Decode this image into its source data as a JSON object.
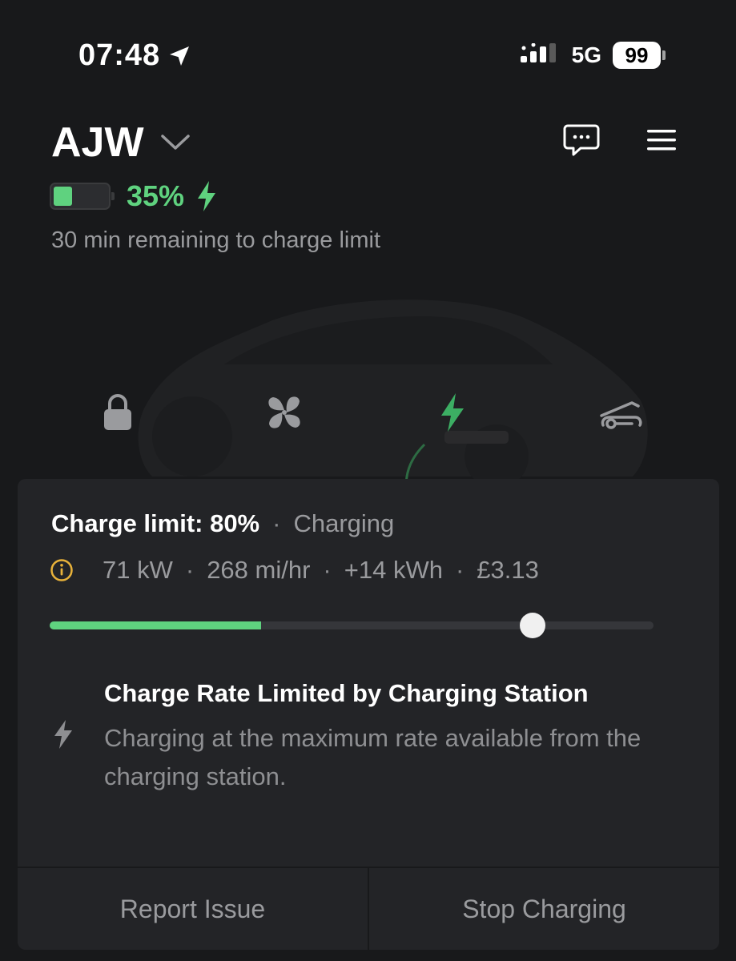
{
  "status_bar": {
    "time": "07:48",
    "network": "5G",
    "battery_level": "99"
  },
  "header": {
    "car_name": "AJW"
  },
  "charge_summary": {
    "percent_text": "35%",
    "battery_fraction": 0.35,
    "time_remaining": "30 min remaining to charge limit"
  },
  "quick_controls": [
    {
      "name": "lock",
      "icon": "lock-icon"
    },
    {
      "name": "climate",
      "icon": "fan-icon"
    },
    {
      "name": "charge",
      "icon": "lightning-icon"
    },
    {
      "name": "frunk",
      "icon": "car-frunk-icon"
    }
  ],
  "card": {
    "charge_limit": "Charge limit: 80%",
    "separator": "·",
    "state": "Charging",
    "stats": [
      "71 kW",
      "268 mi/hr",
      "+14 kWh",
      "£3.13"
    ],
    "slider": {
      "current_level_fraction": 0.35,
      "limit_fraction": 0.8
    },
    "alert_title": "Charge Rate Limited by Charging Station",
    "alert_body": "Charging at the maximum rate available from the charging station.",
    "buttons": {
      "report": "Report Issue",
      "stop": "Stop Charging"
    }
  },
  "colors": {
    "accent_green": "#5fd27f",
    "info_yellow": "#e8b23a",
    "background": "#18191b",
    "card": "#232427"
  }
}
